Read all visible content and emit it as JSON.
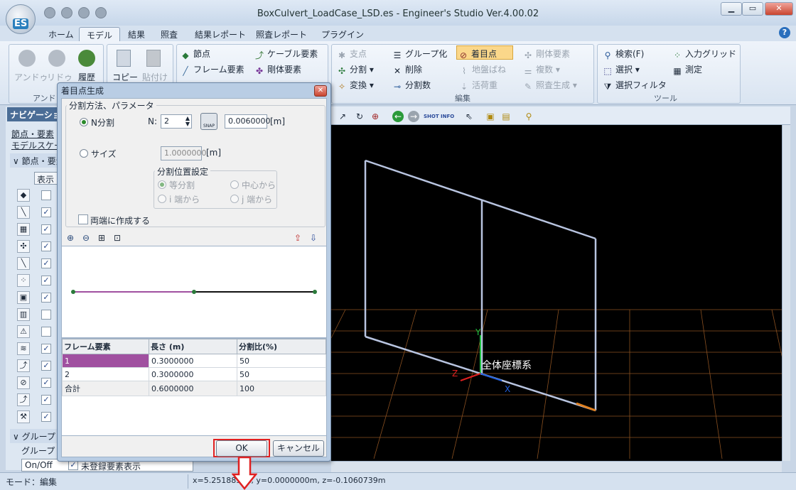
{
  "window": {
    "title": "BoxCulvert_LoadCase_LSD.es - Engineer's Studio Ver.4.00.02",
    "app_badge": "ES"
  },
  "tabs": [
    "ホーム",
    "モデル",
    "結果",
    "照査",
    "結果レポート",
    "照査レポート",
    "プラグイン"
  ],
  "active_tab": "モデル",
  "ribbon": {
    "undo": "アンドゥ",
    "redo": "リドゥ",
    "history": "履歴",
    "group_undo": "アンドゥ",
    "copy": "コピー",
    "paste": "貼付け",
    "node": "節点",
    "frame": "フレーム要素",
    "cable": "ケーブル要素",
    "rigid": "剛体要素",
    "support": "支点",
    "split": "分割",
    "transform": "変換",
    "group": "グループ化",
    "delete": "削除",
    "split_count": "分割数",
    "focus_point": "着目点",
    "ground_spring": "地盤ばね",
    "live_load": "活荷重",
    "rigid2": "剛体要素",
    "duplicate": "複数",
    "check_gen": "照査生成",
    "group_edit": "編集",
    "search": "検索(F)",
    "select": "選択",
    "select_filter": "選択フィルタ",
    "input_grid": "入力グリッド",
    "measure": "測定",
    "group_tools": "ツール"
  },
  "nav": {
    "header": "ナビゲーション",
    "link1": "節点・要素",
    "link2": "モデルスケール",
    "section": "節点・要素",
    "show_btn": "表示",
    "rows": [
      false,
      true,
      true,
      true,
      true,
      true,
      true,
      false,
      false,
      true,
      true,
      true,
      true,
      true
    ],
    "group_section": "グループ",
    "group_tab": "グループ",
    "onoff": "On/Off",
    "unassigned": "未登録要素表示"
  },
  "dialog": {
    "title": "着目点生成",
    "method_legend": "分割方法、パラメータ",
    "n_split": "N分割",
    "n_label": "N:",
    "n_value": "2",
    "snap": "SNAP",
    "length_value": "0.0060000",
    "unit_m": "[m]",
    "size": "サイズ",
    "size_value": "1.0000000",
    "position_legend": "分割位置設定",
    "equal": "等分割",
    "from_center": "中心から",
    "from_i": "i 端から",
    "from_j": "j 端から",
    "both_ends": "両端に作成する",
    "table": {
      "headers": [
        "フレーム要素",
        "長さ (m)",
        "分割比(%)"
      ],
      "rows": [
        [
          "1",
          "0.3000000",
          "50"
        ],
        [
          "2",
          "0.3000000",
          "50"
        ],
        [
          "合計",
          "0.6000000",
          "100"
        ]
      ]
    },
    "ok": "OK",
    "cancel": "キャンセル"
  },
  "viewport": {
    "axes_label": "全体座標系",
    "x": "X",
    "y": "Y",
    "z": "Z"
  },
  "status": {
    "mode": "モード：編集",
    "coords": "x=5.251885 m, y=0.0000000m, z=-0.1060739m"
  },
  "colors": {
    "highlight": "#e02020",
    "segment1": "#a050a0",
    "segment2": "#101010",
    "node": "#2a7a3a",
    "frame_line": "#b8c4e0"
  }
}
